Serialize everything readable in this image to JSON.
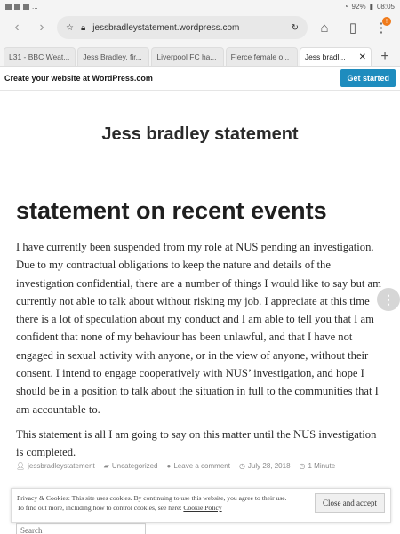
{
  "status": {
    "left_text": "...",
    "battery": "92%",
    "time": "08:05"
  },
  "toolbar": {
    "back_icon": "chevron-left-icon",
    "forward_icon": "chevron-right-icon",
    "url": "jessbradleystatement.wordpress.com"
  },
  "tabs": [
    {
      "label": "L31 - BBC Weat..."
    },
    {
      "label": "Jess Bradley, fir..."
    },
    {
      "label": "Liverpool FC ha..."
    },
    {
      "label": "Fierce female o..."
    },
    {
      "label": "Jess bradl..."
    }
  ],
  "wpbar": {
    "create_text": "Create your website at WordPress.com",
    "cta": "Get started",
    "cta_color": "#1e8cbe"
  },
  "site": {
    "title": "Jess bradley statement"
  },
  "post": {
    "title": "statement on recent events",
    "paragraphs": [
      "I have currently been suspended from my role at NUS pending an investigation. Due to my contractual obligations to keep the nature and details of the investigation confidential, there are a number of things I would like to say but am currently not able to talk about without risking my job. I appreciate at this time there is a lot of speculation about my conduct and I am able to tell you that I am confident that none of my behaviour has been unlawful, and that I have not engaged in sexual activity with anyone, or in the view of anyone, without their consent. I intend to engage cooperatively with NUS’ investigation, and hope I should be in a position to talk about the situation in full to the communities that I am accountable to.",
      "This statement is all I am going to say on this matter until the NUS investigation is completed."
    ],
    "meta": {
      "author": "jessbradleystatement",
      "category": "Uncategorized",
      "comment": "Leave a comment",
      "date": "July 28, 2018",
      "read_time": "1 Minute"
    }
  },
  "cookie": {
    "line1": "Privacy & Cookies: This site uses cookies. By continuing to use this website, you agree to their use.",
    "line2_prefix": "To find out more, including how to control cookies, see here: ",
    "policy_link": "Cookie Policy",
    "accept_label": "Close and accept"
  },
  "search": {
    "placeholder": "Search"
  }
}
